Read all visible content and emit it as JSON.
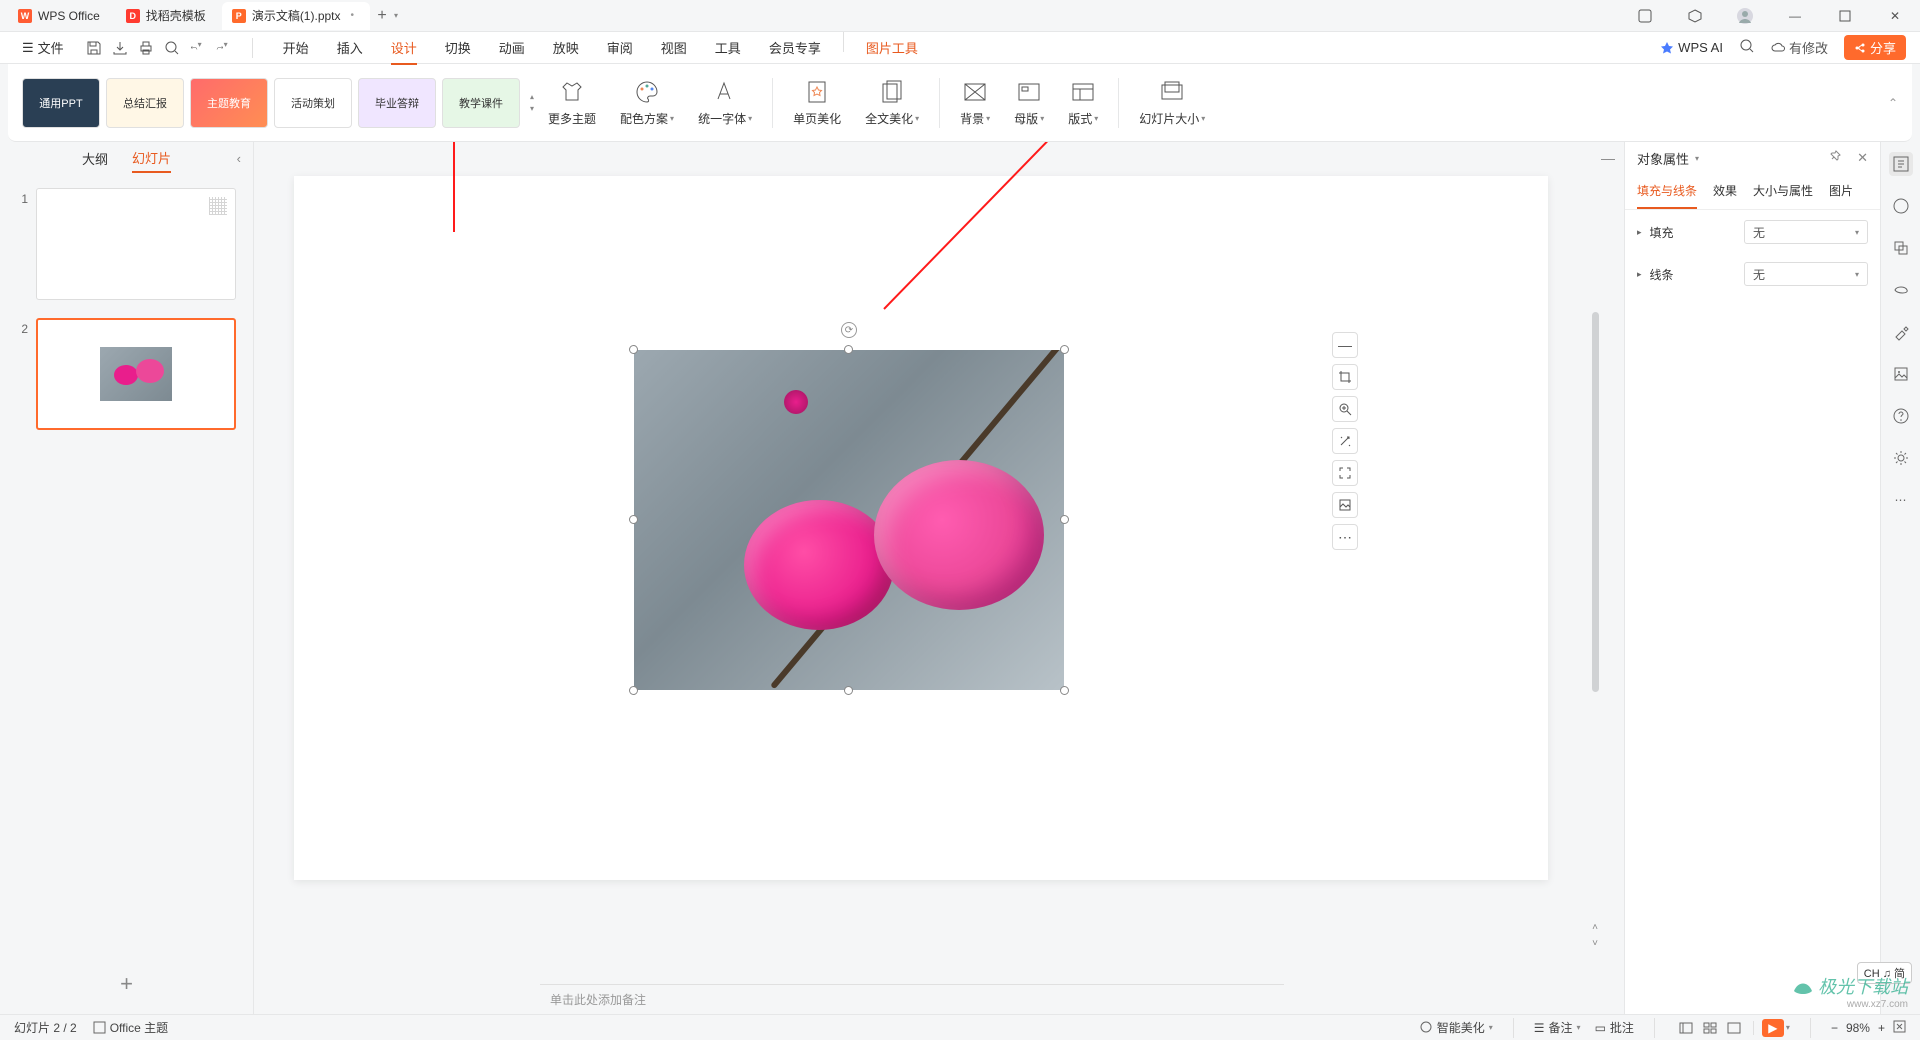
{
  "titlebar": {
    "tabs": [
      {
        "label": "WPS Office",
        "icon_bg": "#ff5c33",
        "icon_text": "W"
      },
      {
        "label": "找稻壳模板",
        "icon_bg": "#ff3b30",
        "icon_text": "D"
      },
      {
        "label": "演示文稿(1).pptx",
        "icon_bg": "#ff6a2c",
        "icon_text": "P",
        "active": true
      }
    ],
    "add": "+"
  },
  "menubar": {
    "file": "文件",
    "tabs": [
      "开始",
      "插入",
      "设计",
      "切换",
      "动画",
      "放映",
      "审阅",
      "视图",
      "工具",
      "会员专享"
    ],
    "active_tab": "设计",
    "contextual_tab": "图片工具",
    "wps_ai": "WPS AI",
    "has_edit": "有修改",
    "share": "分享"
  },
  "ribbon": {
    "templates": [
      "通用PPT",
      "总结汇报",
      "主题教育",
      "活动策划",
      "毕业答辩",
      "教学课件"
    ],
    "items": [
      {
        "label": "更多主题",
        "dd": false
      },
      {
        "label": "配色方案",
        "dd": true
      },
      {
        "label": "统一字体",
        "dd": true
      },
      {
        "label": "单页美化",
        "dd": false
      },
      {
        "label": "全文美化",
        "dd": true
      },
      {
        "label": "背景",
        "dd": true
      },
      {
        "label": "母版",
        "dd": true
      },
      {
        "label": "版式",
        "dd": true
      },
      {
        "label": "幻灯片大小",
        "dd": true
      }
    ]
  },
  "slide_panel": {
    "tab_outline": "大纲",
    "tab_slides": "幻灯片",
    "thumbs": [
      1,
      2
    ]
  },
  "notes_placeholder": "单击此处添加备注",
  "prop_panel": {
    "title": "对象属性",
    "tabs": [
      "填充与线条",
      "效果",
      "大小与属性",
      "图片"
    ],
    "active_tab": "填充与线条",
    "fill_label": "填充",
    "fill_value": "无",
    "line_label": "线条",
    "line_value": "无"
  },
  "statusbar": {
    "slide_pos": "幻灯片 2 / 2",
    "theme": "Office 主题",
    "smart_beautify": "智能美化",
    "notes": "备注",
    "comments": "批注",
    "zoom": "98%"
  },
  "ime": "CH ♫ 简",
  "watermark": {
    "main": "极光下载站",
    "url": "www.xz7.com"
  }
}
